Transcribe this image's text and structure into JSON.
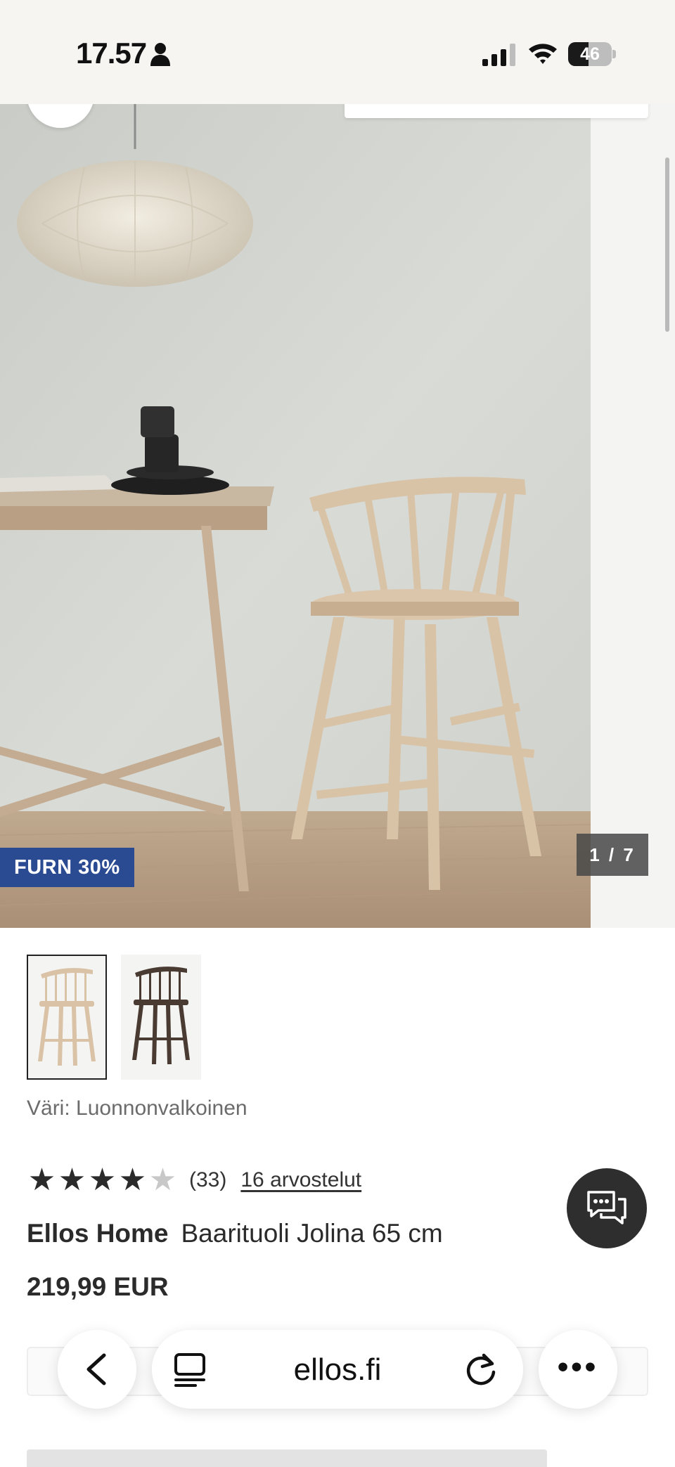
{
  "status_bar": {
    "time": "17.57",
    "battery": "46",
    "battery_level": 0.46,
    "icons": [
      "person-icon",
      "cellular-signal-icon",
      "wifi-icon",
      "battery-icon"
    ]
  },
  "gallery": {
    "badge": "FURN 30%",
    "counter": "1 / 7",
    "current_image": 1,
    "total_images": 7,
    "badge_color": "#2a4a92"
  },
  "thumbnails": [
    {
      "name": "natural-white-stool",
      "color": "#d9c2a6",
      "selected": true
    },
    {
      "name": "dark-brown-stool",
      "color": "#4a3b32",
      "selected": false
    }
  ],
  "product": {
    "color_label": "Väri: Luonnonvalkoinen",
    "rating_value": 4,
    "rating_max": 5,
    "rating_count": "(33)",
    "reviews_link": "16 arvostelut",
    "brand": "Ellos Home",
    "name": "Baarituoli Jolina 65 cm",
    "price": "219,99 EUR"
  },
  "browser": {
    "url": "ellos.fi",
    "icons": [
      "back-chevron-icon",
      "tabs-icon",
      "reload-icon",
      "more-icon"
    ]
  },
  "chat": {
    "icon": "chat-bubbles-icon",
    "color": "#2e2e2e"
  }
}
